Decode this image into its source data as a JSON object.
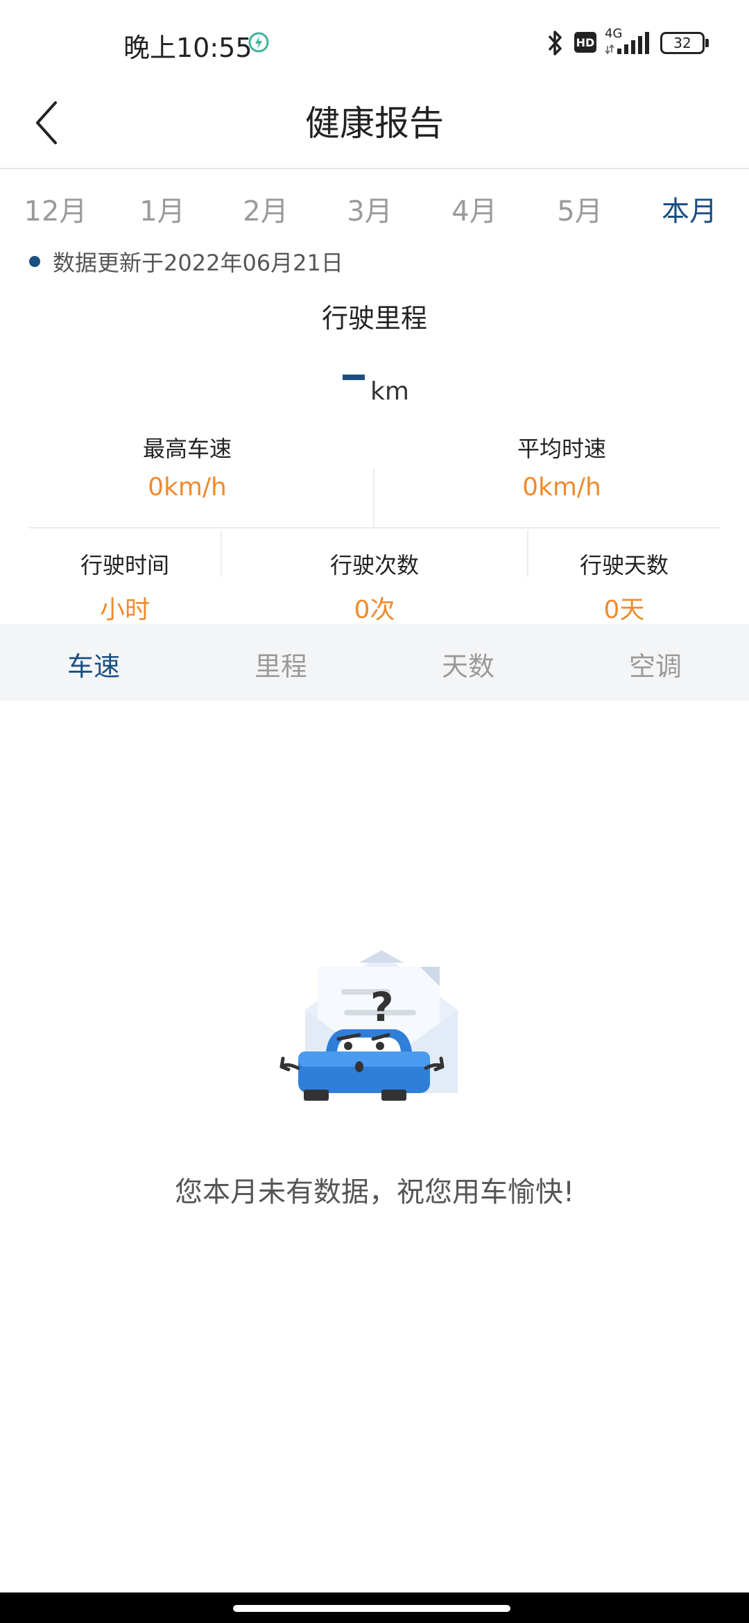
{
  "status_bar": {
    "time": "晚上10:55",
    "hd": "HD",
    "network": "4G",
    "battery": "32"
  },
  "header": {
    "title": "健康报告"
  },
  "month_tabs": [
    {
      "label": "12月",
      "active": false
    },
    {
      "label": "1月",
      "active": false
    },
    {
      "label": "2月",
      "active": false
    },
    {
      "label": "3月",
      "active": false
    },
    {
      "label": "4月",
      "active": false
    },
    {
      "label": "5月",
      "active": false
    },
    {
      "label": "本月",
      "active": true
    }
  ],
  "update_text": "数据更新于2022年06月21日",
  "mileage": {
    "title": "行驶里程",
    "unit": "km"
  },
  "stats_top": [
    {
      "label": "最高车速",
      "value": "0km/h"
    },
    {
      "label": "平均时速",
      "value": "0km/h"
    }
  ],
  "stats_bottom": [
    {
      "label": "行驶时间",
      "value": "小时"
    },
    {
      "label": "行驶次数",
      "value": "0次"
    },
    {
      "label": "行驶天数",
      "value": "0天"
    }
  ],
  "category_tabs": [
    {
      "label": "车速",
      "active": true
    },
    {
      "label": "里程",
      "active": false
    },
    {
      "label": "天数",
      "active": false
    },
    {
      "label": "空调",
      "active": false
    }
  ],
  "empty_message": "您本月未有数据，祝您用车愉快!",
  "colors": {
    "accent": "#1b4f82",
    "value": "#f08a2b",
    "tab_bg": "#f4f5f7",
    "car_blue": "#2f7fd9"
  },
  "icons": {
    "back": "chevron-left-icon",
    "bluetooth": "bluetooth-icon",
    "charging": "charging-icon",
    "signal": "signal-icon",
    "battery": "battery-icon",
    "empty": "confused-car-icon"
  }
}
